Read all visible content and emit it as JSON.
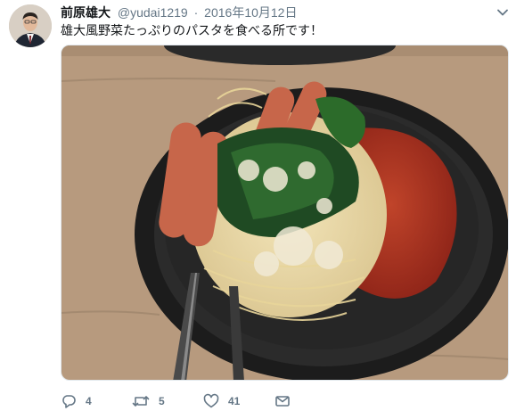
{
  "tweet": {
    "author_name": "前原雄大",
    "handle": "@yudai1219",
    "separator": "·",
    "date": "2016年10月12日",
    "text": "雄大風野菜たっぷりのパスタを食べる所です！"
  },
  "actions": {
    "reply_count": "4",
    "retweet_count": "5",
    "like_count": "41"
  },
  "icons": [
    "avatar",
    "chevron-down-icon",
    "reply-icon",
    "retweet-icon",
    "like-icon",
    "message-icon"
  ],
  "colors": {
    "text": "#14171a",
    "secondary": "#657786",
    "border": "#e1e8ed"
  }
}
